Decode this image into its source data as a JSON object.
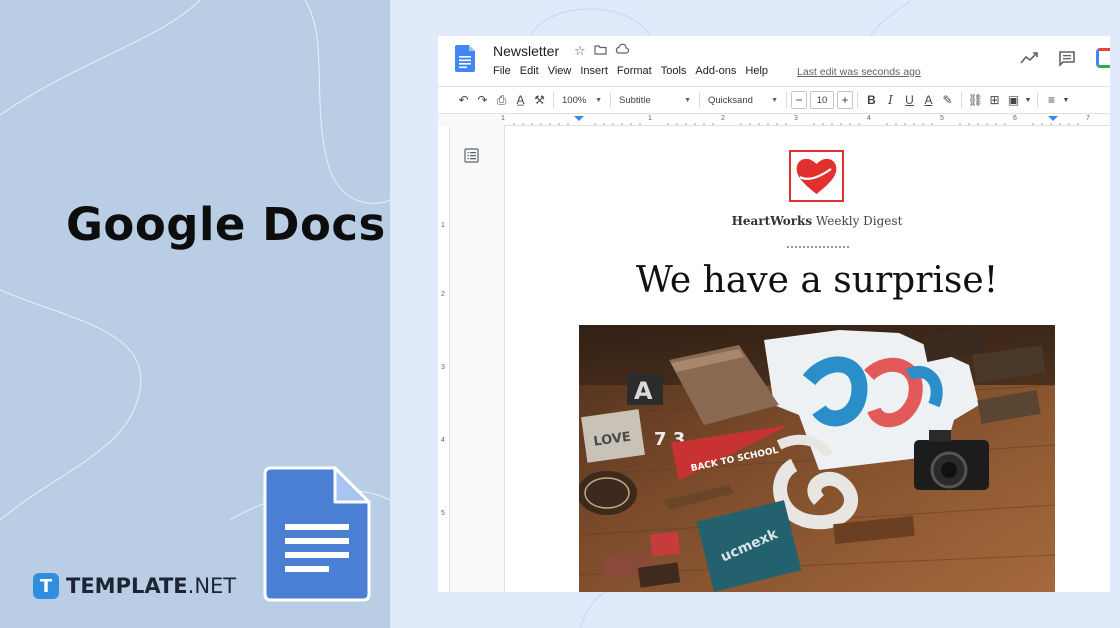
{
  "promo": {
    "title": "Google Docs",
    "brand_mark": "T",
    "brand_name_bold": "TEMPLATE",
    "brand_name_light": ".NET"
  },
  "docs": {
    "doc_title": "Newsletter",
    "menu": [
      "File",
      "Edit",
      "View",
      "Insert",
      "Format",
      "Tools",
      "Add-ons",
      "Help"
    ],
    "last_edit": "Last edit was seconds ago",
    "toolbar": {
      "zoom": "100%",
      "style": "Subtitle",
      "font": "Quicksand",
      "font_size": "10",
      "minus": "−",
      "plus": "+"
    },
    "ruler_h": [
      "1",
      "1",
      "2",
      "3",
      "4",
      "5",
      "6",
      "7"
    ],
    "ruler_v": [
      "1",
      "2",
      "3",
      "4",
      "5"
    ]
  },
  "content": {
    "brand_bold": "HeartWorks",
    "brand_rest": " Weekly Digest",
    "headline": "We have a surprise!",
    "photo_sign_1": "BACK TO SCHOOL",
    "photo_sign_2": "LOVE",
    "photo_sign_3": "ucmexk"
  },
  "colors": {
    "accent_red": "#e0312f",
    "docs_blue": "#4285f4",
    "panel_blue": "#b9cde4"
  },
  "icons": [
    "undo-icon",
    "redo-icon",
    "print-icon",
    "spellcheck-icon",
    "paint-format-icon",
    "star-icon",
    "folder-icon",
    "cloud-icon",
    "trending-icon",
    "comment-icon",
    "bold-icon",
    "italic-icon",
    "underline-icon",
    "text-color-icon",
    "highlight-icon",
    "link-icon",
    "add-comment-icon",
    "image-icon",
    "align-icon",
    "outline-icon"
  ]
}
